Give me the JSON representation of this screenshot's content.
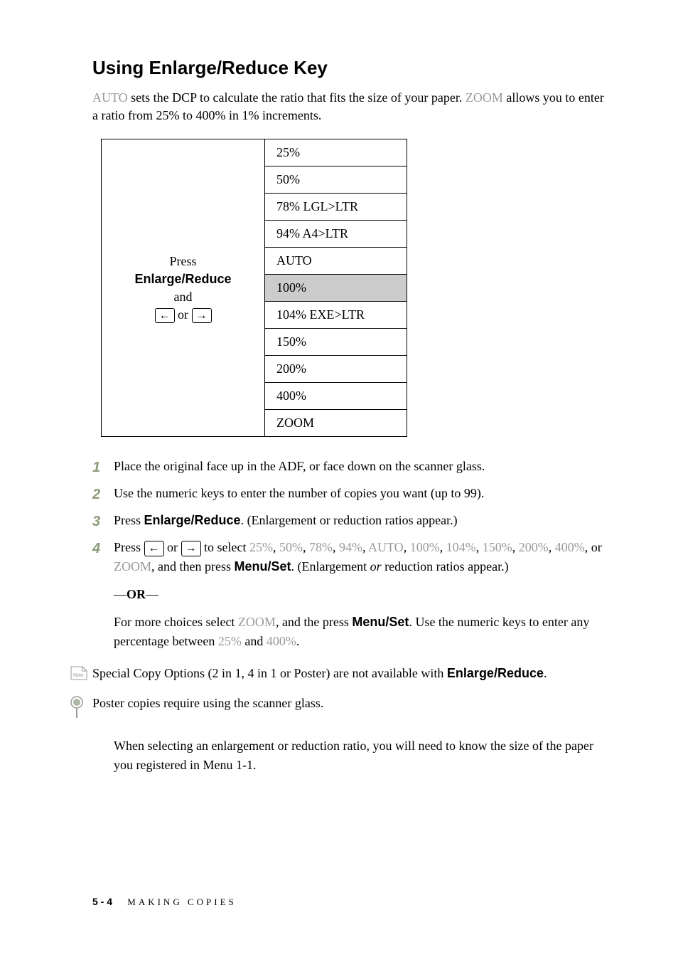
{
  "heading": "Using Enlarge/Reduce Key",
  "intro": {
    "auto_label": "AUTO",
    "auto_text": " sets the DCP to calculate the ratio that fits the size of your paper. ",
    "zoom_label": "ZOOM",
    "zoom_text": " allows you to enter a ratio from 25% to 400% in 1% increments."
  },
  "table": {
    "left_press": "Press",
    "left_bold": "Enlarge/Reduce",
    "left_and": "and",
    "left_or": "or",
    "rows": [
      "25%",
      "50%",
      "78% LGL>LTR",
      "94% A4>LTR",
      "AUTO",
      "100%",
      "104% EXE>LTR",
      "150%",
      "200%",
      "400%",
      "ZOOM"
    ]
  },
  "steps": {
    "s1": "Place the original face up in the ADF, or face down on the scanner glass.",
    "s2": "Use the numeric keys to enter the number of copies you want (up to 99).",
    "s3_a": "Press ",
    "s3_b": "Enlarge/Reduce",
    "s3_c": ". (Enlargement or reduction ratios appear.)",
    "s4_a": "Press ",
    "s4_b": " or ",
    "s4_c": " to select ",
    "s4_opt1": "25%",
    "s4_opt2": "50%",
    "s4_opt3": "78%",
    "s4_opt4": "94%",
    "s4_opt5": "AUTO",
    "s4_opt6": "100%",
    "s4_opt7": "104%",
    "s4_opt8": "150%",
    "s4_opt9": "200%",
    "s4_opt10": "400%",
    "s4_opt11": "ZOOM",
    "s4_d": ", and then press ",
    "s4_e": "Menu/Set",
    "s4_f": ". (Enlargement ",
    "s4_g": "or",
    "s4_h": " reduction ratios appear.)",
    "or_a": "—",
    "or_b": "OR",
    "or_c": "—",
    "zoom_a": "For  more choices select ",
    "zoom_b": "ZOOM",
    "zoom_c": ", and the press ",
    "zoom_d": "Menu/Set",
    "zoom_e": ". Use the numeric keys to enter any percentage between ",
    "zoom_f": "25%",
    "zoom_g": " and ",
    "zoom_h": "400%",
    "zoom_i": "."
  },
  "note1_a": "Special Copy Options (2 in 1, 4 in 1 or Poster) are not available with ",
  "note1_b": "Enlarge/Reduce",
  "note1_c": ".",
  "note2": "Poster copies require using the scanner glass.",
  "note3": "When selecting an enlargement or reduction ratio, you will need to know the size of the paper you registered in Menu 1-1.",
  "footer": {
    "page": "5 - 4",
    "section": "MAKING COPIES"
  }
}
